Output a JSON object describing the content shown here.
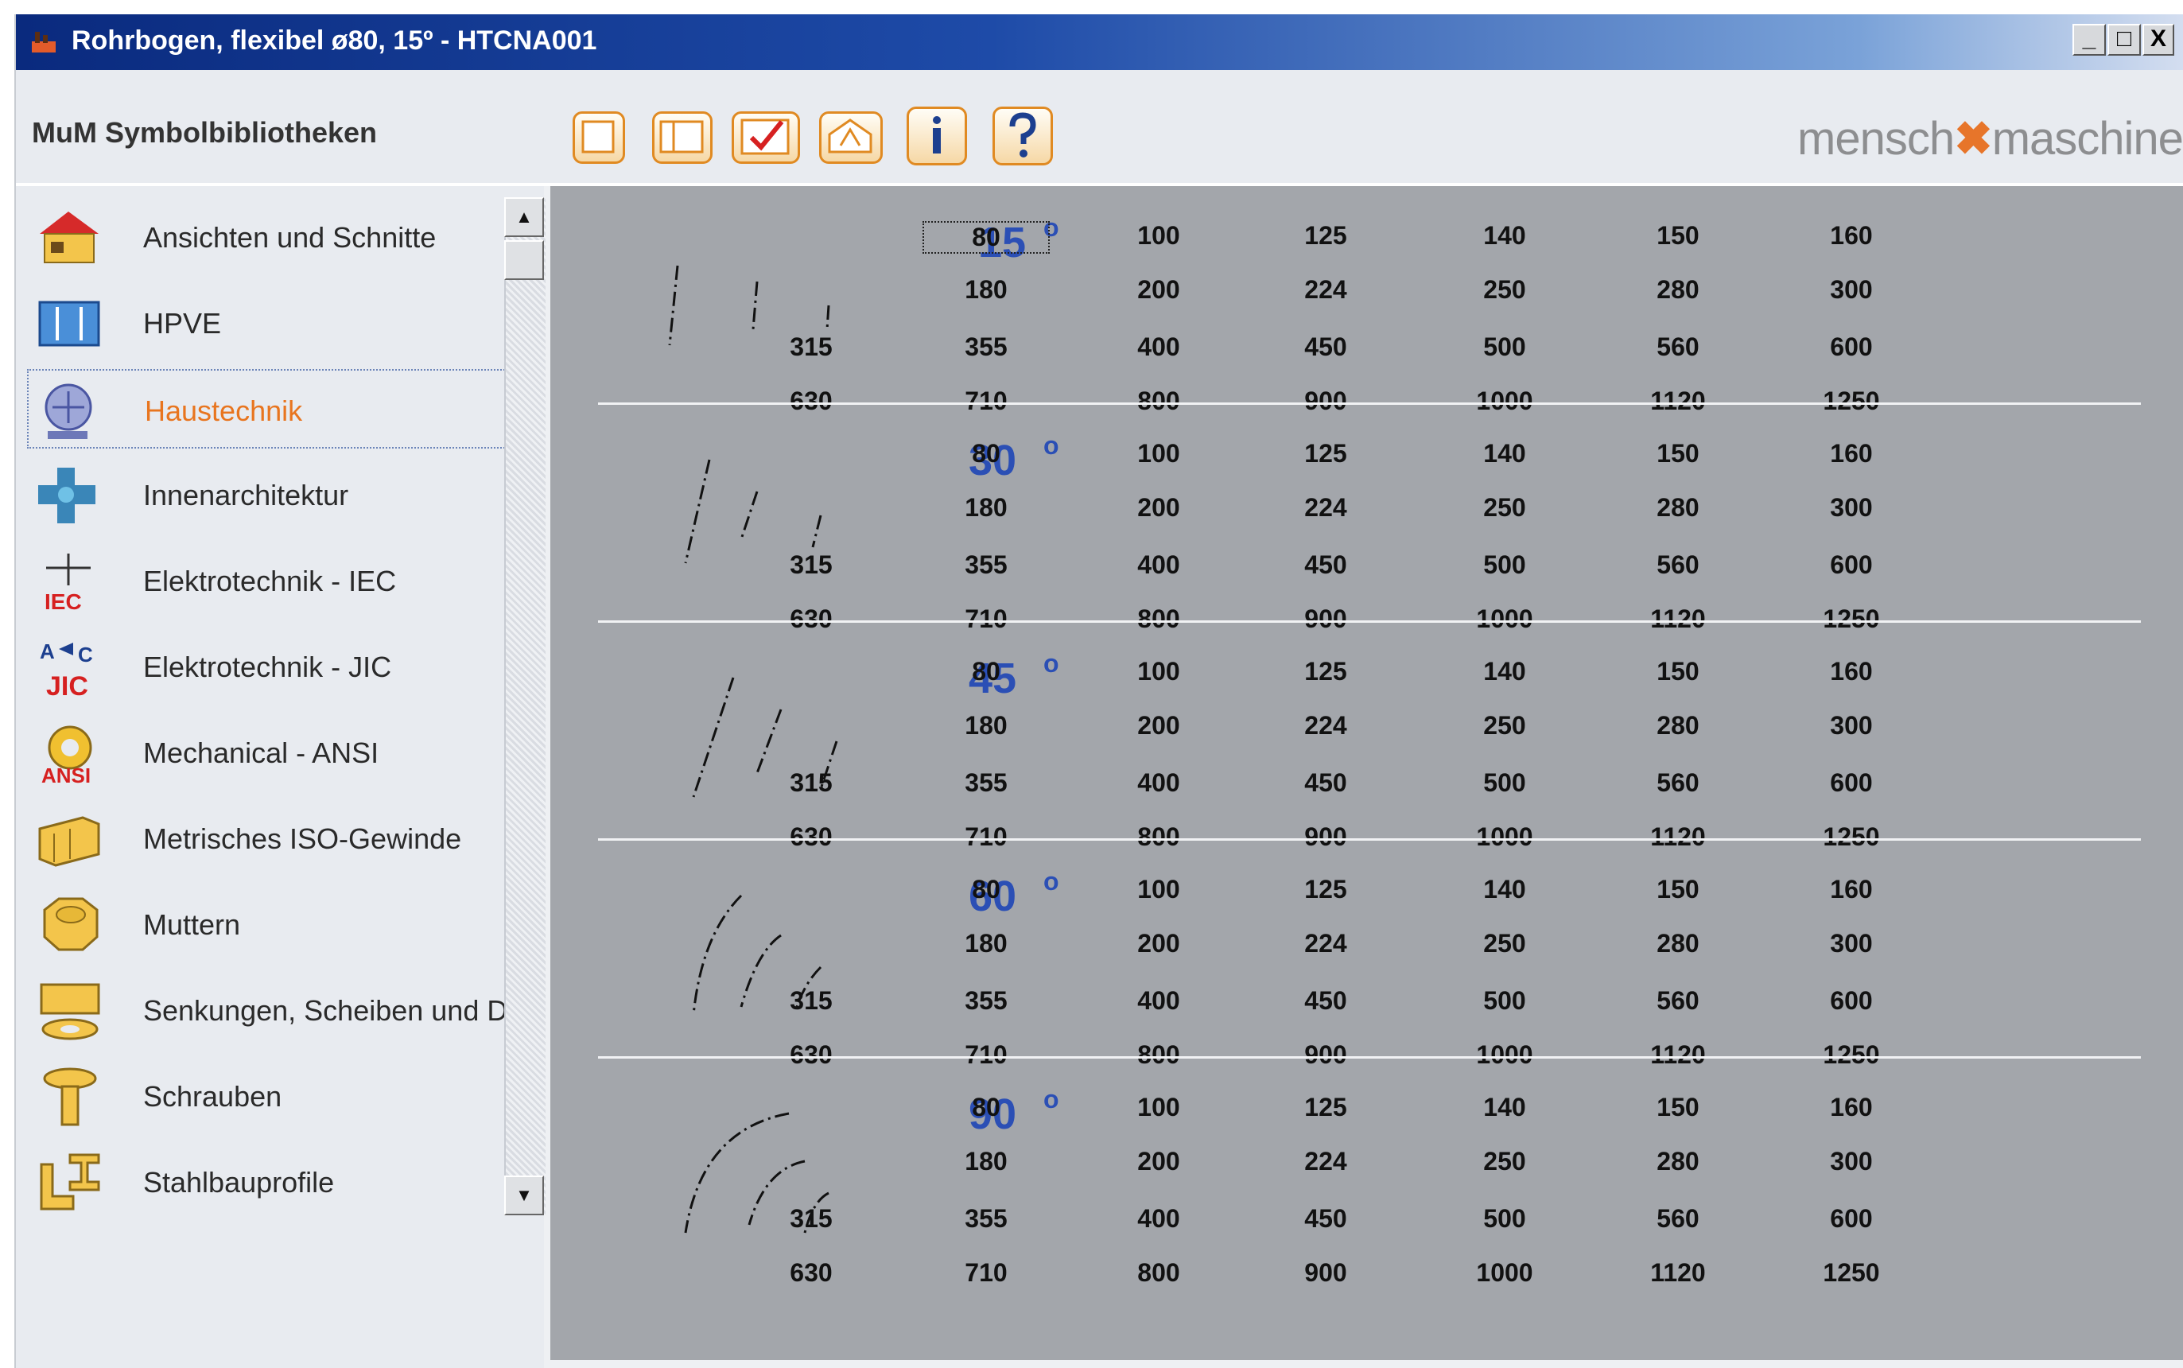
{
  "window": {
    "title": "Rohrbogen, flexibel ø80, 15º - HTCNA001",
    "minimize": "_",
    "maximize": "□",
    "close": "X"
  },
  "header": {
    "library_title": "MuM Symbolbibliotheken",
    "logo_left": "mensch",
    "logo_mid": "✖",
    "logo_right": "maschine"
  },
  "sidebar": {
    "items": [
      {
        "label": "Ansichten und Schnitte",
        "icon": "house-icon"
      },
      {
        "label": "HPVE",
        "icon": "hpve-icon"
      },
      {
        "label": "Haustechnik",
        "icon": "hvac-icon",
        "selected": true
      },
      {
        "label": "Innenarchitektur",
        "icon": "interior-icon"
      },
      {
        "label": "Elektrotechnik - IEC",
        "icon": "iec-icon"
      },
      {
        "label": "Elektrotechnik - JIC",
        "icon": "jic-icon"
      },
      {
        "label": "Mechanical - ANSI",
        "icon": "ansi-gear-icon"
      },
      {
        "label": "Metrisches ISO-Gewinde",
        "icon": "thread-icon"
      },
      {
        "label": "Muttern",
        "icon": "nut-icon"
      },
      {
        "label": "Senkungen, Scheiben und Du",
        "icon": "washer-icon"
      },
      {
        "label": "Schrauben",
        "icon": "screw-icon"
      },
      {
        "label": "Stahlbauprofile",
        "icon": "steel-profile-icon"
      }
    ],
    "scroll_up": "▲",
    "scroll_down": "▼"
  },
  "main": {
    "sections": [
      {
        "angle": "15",
        "deg": "o",
        "rows": [
          [
            "80",
            "100",
            "125",
            "140",
            "150",
            "160"
          ],
          [
            "180",
            "200",
            "224",
            "250",
            "280",
            "300"
          ],
          [
            "315",
            "355",
            "400",
            "450",
            "500",
            "560",
            "600"
          ],
          [
            "630",
            "710",
            "800",
            "900",
            "1000",
            "1120",
            "1250"
          ]
        ]
      },
      {
        "angle": "30",
        "deg": "o",
        "rows": [
          [
            "80",
            "100",
            "125",
            "140",
            "150",
            "160"
          ],
          [
            "180",
            "200",
            "224",
            "250",
            "280",
            "300"
          ],
          [
            "315",
            "355",
            "400",
            "450",
            "500",
            "560",
            "600"
          ],
          [
            "630",
            "710",
            "800",
            "900",
            "1000",
            "1120",
            "1250"
          ]
        ]
      },
      {
        "angle": "45",
        "deg": "o",
        "rows": [
          [
            "80",
            "100",
            "125",
            "140",
            "150",
            "160"
          ],
          [
            "180",
            "200",
            "224",
            "250",
            "280",
            "300"
          ],
          [
            "315",
            "355",
            "400",
            "450",
            "500",
            "560",
            "600"
          ],
          [
            "630",
            "710",
            "800",
            "900",
            "1000",
            "1120",
            "1250"
          ]
        ]
      },
      {
        "angle": "60",
        "deg": "o",
        "rows": [
          [
            "80",
            "100",
            "125",
            "140",
            "150",
            "160"
          ],
          [
            "180",
            "200",
            "224",
            "250",
            "280",
            "300"
          ],
          [
            "315",
            "355",
            "400",
            "450",
            "500",
            "560",
            "600"
          ],
          [
            "630",
            "710",
            "800",
            "900",
            "1000",
            "1120",
            "1250"
          ]
        ]
      },
      {
        "angle": "90",
        "deg": "o",
        "rows": [
          [
            "80",
            "100",
            "125",
            "140",
            "150",
            "160"
          ],
          [
            "180",
            "200",
            "224",
            "250",
            "280",
            "300"
          ],
          [
            "315",
            "355",
            "400",
            "450",
            "500",
            "560",
            "600"
          ],
          [
            "630",
            "710",
            "800",
            "900",
            "1000",
            "1120",
            "1250"
          ]
        ]
      }
    ]
  }
}
